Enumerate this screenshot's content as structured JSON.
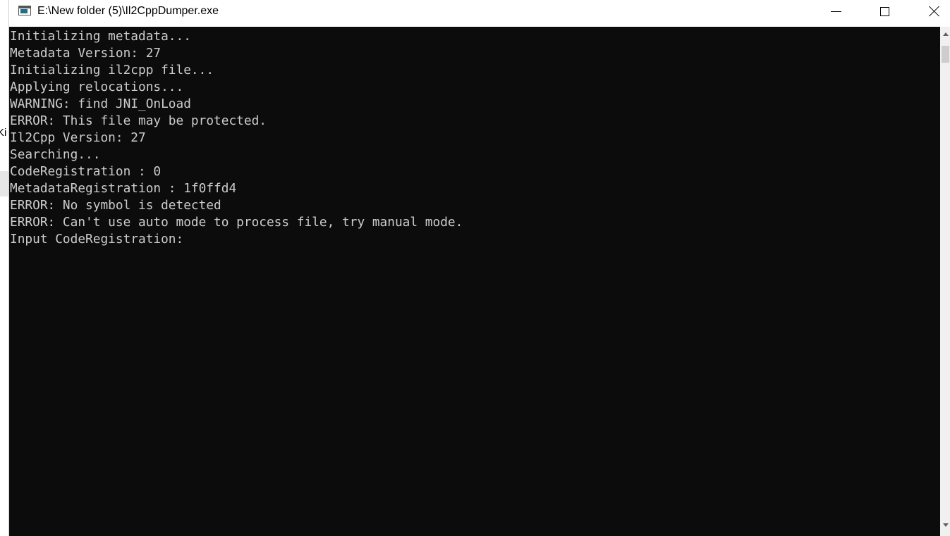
{
  "background": {
    "partial_text": "Ki"
  },
  "window": {
    "title": "E:\\New folder (5)\\Il2CppDumper.exe",
    "buttons": {
      "minimize": "minimize",
      "maximize": "maximize",
      "close": "close"
    }
  },
  "console": {
    "background_color": "#0c0c0c",
    "text_color": "#cccccc",
    "lines": [
      "Initializing metadata...",
      "Metadata Version: 27",
      "Initializing il2cpp file...",
      "Applying relocations...",
      "WARNING: find JNI_OnLoad",
      "ERROR: This file may be protected.",
      "Il2Cpp Version: 27",
      "Searching...",
      "CodeRegistration : 0",
      "MetadataRegistration : 1f0ffd4",
      "ERROR: No symbol is detected",
      "ERROR: Can't use auto mode to process file, try manual mode.",
      "Input CodeRegistration:"
    ]
  },
  "icons": {
    "app": "console-app-icon",
    "minimize": "minimize-icon",
    "maximize": "maximize-icon",
    "close": "close-icon",
    "scroll_up": "scroll-up-arrow-icon",
    "scroll_down": "scroll-down-arrow-icon"
  }
}
